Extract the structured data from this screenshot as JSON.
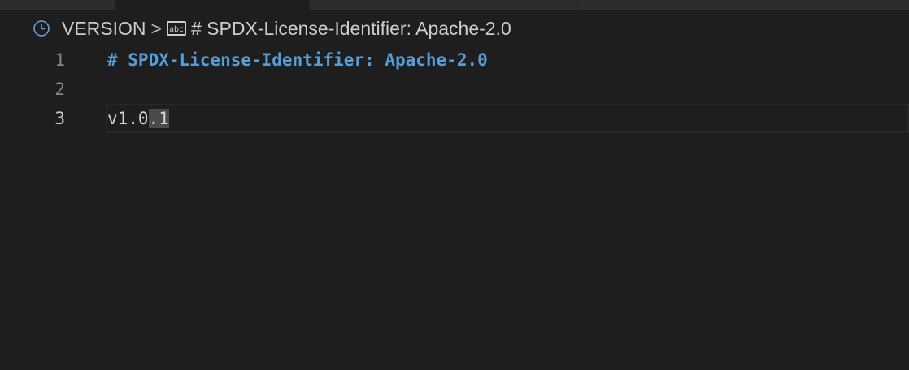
{
  "tabs": [
    {
      "active": false
    },
    {
      "active": true
    },
    {
      "active": false
    },
    {
      "active": false
    },
    {
      "active": false
    }
  ],
  "breadcrumb": {
    "icon": "clock-icon",
    "file": "VERSION",
    "separator": ">",
    "symbol_icon": "abc-string-icon",
    "symbol_icon_text": "abc",
    "symbol": "# SPDX-License-Identifier: Apache-2.0"
  },
  "editor": {
    "current_line": 3,
    "lines": [
      {
        "number": "1",
        "text": "# SPDX-License-Identifier: Apache-2.0"
      },
      {
        "number": "2",
        "text": ""
      },
      {
        "number": "3",
        "text_before": "v1.0",
        "text_selected": ".1"
      }
    ]
  },
  "colors": {
    "background": "#1e1e1e",
    "comment": "#569cd6",
    "tab_inactive": "#2d2d2d"
  }
}
